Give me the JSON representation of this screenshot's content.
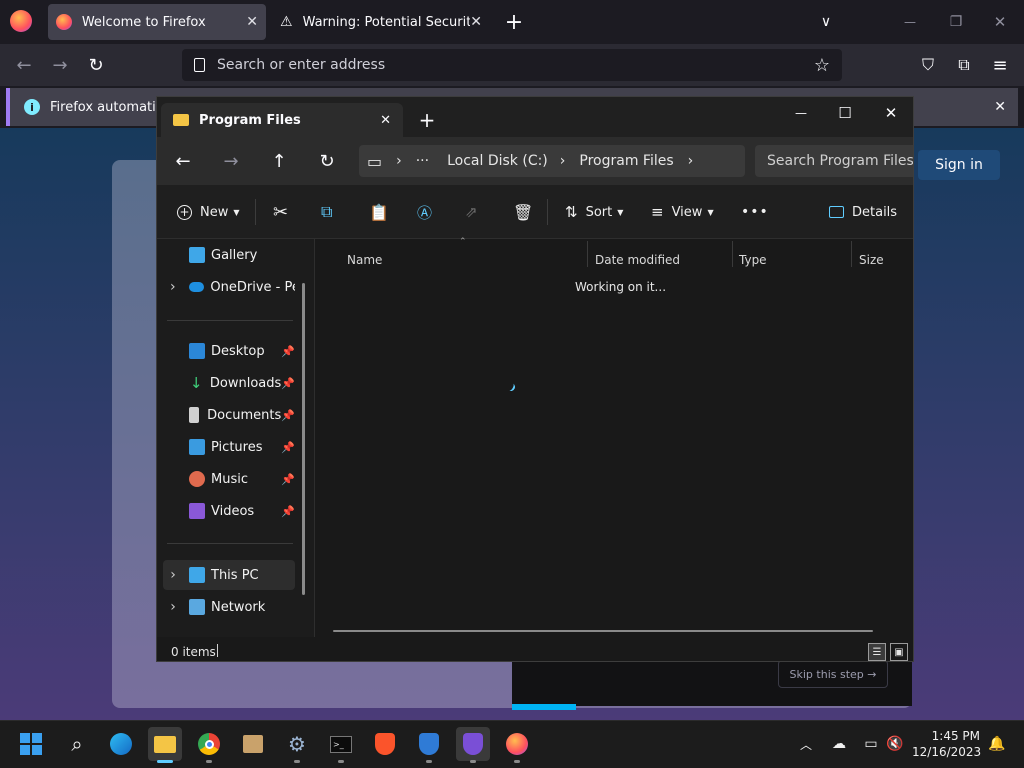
{
  "firefox": {
    "tabs": [
      {
        "title": "Welcome to Firefox",
        "icon": "firefox-icon"
      },
      {
        "title": "Warning: Potential Security Risk",
        "icon": "warning-icon"
      }
    ],
    "new_tab": "+",
    "tab_list": "∨",
    "window_controls": {
      "minimize": "—",
      "restore": "❐",
      "close": "✕"
    },
    "toolbar": {
      "back": "←",
      "forward": "→",
      "reload": "↻"
    },
    "urlbar": {
      "placeholder": "Search or enter address",
      "star": "☆"
    },
    "toolbar_right": {
      "pocket": "⛉",
      "extensions": "⧉",
      "menu": "≡"
    },
    "notification": {
      "icon": "i",
      "text": "Firefox automatically",
      "close": "✕"
    }
  },
  "page": {
    "signin_label": "Sign in",
    "skip_label": "Skip this step →",
    "progress": 0.16
  },
  "explorer": {
    "tab_title": "Program Files",
    "tab_close": "✕",
    "new_tab": "+",
    "window_controls": {
      "minimize": "—",
      "maximize": "☐",
      "close": "✕"
    },
    "nav": {
      "back": "←",
      "forward": "→",
      "up": "↑",
      "refresh": "↻"
    },
    "address": {
      "pc_icon": "▭",
      "sep": "›",
      "more": "···",
      "segments": [
        "Local Disk (C:)",
        "Program Files"
      ]
    },
    "search_placeholder": "Search Program Files",
    "commands": {
      "new": "New",
      "sort": "Sort",
      "view": "View",
      "more": "•••",
      "details": "Details"
    },
    "sidebar": {
      "top": [
        {
          "label": "Gallery",
          "icon": "gallery-icon"
        },
        {
          "label": "OneDrive - Perso",
          "icon": "onedrive-icon"
        }
      ],
      "quick": [
        {
          "label": "Desktop",
          "icon": "desktop-icon"
        },
        {
          "label": "Downloads",
          "icon": "downloads-icon"
        },
        {
          "label": "Documents",
          "icon": "documents-icon"
        },
        {
          "label": "Pictures",
          "icon": "pictures-icon"
        },
        {
          "label": "Music",
          "icon": "music-icon"
        },
        {
          "label": "Videos",
          "icon": "videos-icon"
        }
      ],
      "bottom": [
        {
          "label": "This PC",
          "icon": "this-pc-icon"
        },
        {
          "label": "Network",
          "icon": "network-icon"
        }
      ],
      "pin": "📌"
    },
    "columns": [
      "Name",
      "Date modified",
      "Type",
      "Size"
    ],
    "loading_text": "Working on it...",
    "status": "0 items"
  },
  "taskbar": {
    "apps": [
      "start-icon",
      "search-icon",
      "edge-dev-icon",
      "file-explorer-icon",
      "chrome-icon",
      "store-icon",
      "settings-icon",
      "terminal-icon",
      "brave-icon",
      "brave-beta-icon",
      "brave-nightly-icon",
      "firefox-icon"
    ],
    "time": "1:45 PM",
    "date": "12/16/2023"
  },
  "colors": {
    "accent": "#60cdff",
    "firefox_bg": "#1c1b22",
    "explorer_bg": "#191919"
  }
}
